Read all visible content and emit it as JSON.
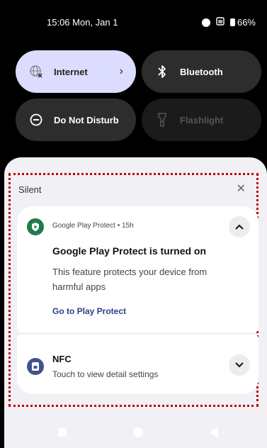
{
  "status": {
    "time": "15:06 Mon, Jan 1",
    "battery": "66%",
    "icons": [
      "record-dot-icon",
      "sim-icon",
      "battery-icon"
    ]
  },
  "quick_settings": {
    "internet": {
      "label": "Internet",
      "icon": "globe-x-icon",
      "active": true
    },
    "bluetooth": {
      "label": "Bluetooth",
      "icon": "bluetooth-icon",
      "active": false
    },
    "dnd": {
      "label": "Do Not Disturb",
      "icon": "minus-circle-icon",
      "active": false
    },
    "flashlight": {
      "label": "Flashlight",
      "icon": "flashlight-icon",
      "active": false,
      "disabled": true
    }
  },
  "notifications": {
    "section": "Silent",
    "items": [
      {
        "app": "Google Play Protect",
        "time": "15h",
        "title": "Google Play Protect is turned on",
        "body": "This feature protects your device from harmful apps",
        "action": "Go to Play Protect",
        "expanded": true
      },
      {
        "title": "NFC",
        "body": "Touch to view detail settings",
        "expanded": false
      }
    ]
  },
  "colors": {
    "internet_tile": "#dcdcff",
    "tile_dark": "#2d2d2d",
    "shade": "#f0f0f5",
    "focus_border": "#c00000",
    "action_link": "#26418c"
  }
}
